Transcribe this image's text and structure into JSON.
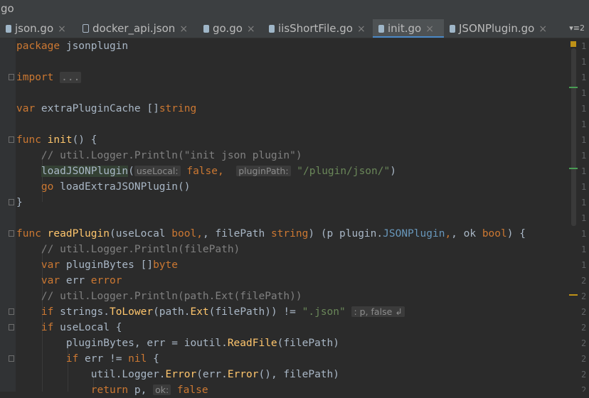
{
  "window": {
    "title": "go"
  },
  "tabs": [
    {
      "label": "json.go",
      "icon": "go-file-icon",
      "active": false
    },
    {
      "label": "docker_api.json",
      "icon": "json-file-icon",
      "active": false
    },
    {
      "label": "go.go",
      "icon": "go-file-icon",
      "active": false
    },
    {
      "label": "iisShortFile.go",
      "icon": "go-file-icon",
      "active": false
    },
    {
      "label": "init.go",
      "icon": "go-file-icon",
      "active": true
    },
    {
      "label": "JSONPlugin.go",
      "icon": "go-file-icon",
      "active": false
    }
  ],
  "tab_close_glyph": "×",
  "tab_overflow": {
    "label": "≡2"
  },
  "code": {
    "package_kw": "package",
    "package_name": " jsonplugin",
    "import_kw": "import",
    "import_collapsed": "...",
    "var_kw": "var",
    "extra_cache": " extraPluginCache []",
    "string_type": "string",
    "func_kw": "func",
    "init_name": "init",
    "init_sig": "() {",
    "comment_init": "// util.Logger.Println(\"init json plugin\")",
    "load_fn": "loadJSONPlugin",
    "load_open": "(",
    "hint_use_local": "useLocal:",
    "false_kw": "false",
    "comma": ", ",
    "hint_plugin_path": "pluginPath:",
    "plugin_path_str": "\"/plugin/json/\"",
    "close_paren": ")",
    "go_kw": "go",
    "load_extra": " loadExtraJSONPlugin()",
    "close_brace": "}",
    "read_plugin": "readPlugin",
    "read_sig_a": "(useLocal ",
    "bool_kw": "bool",
    "read_sig_b": ", filePath ",
    "read_sig_c": ") (p ",
    "plugin_pkg": "plugin.",
    "plugin_type": "JSONPlugin",
    "read_sig_d": ", ok ",
    "read_sig_e": ") {",
    "comment_filepath": "// util.Logger.Println(filePath)",
    "plugin_bytes": " pluginBytes []",
    "byte_kw": "byte",
    "err_decl": " err ",
    "error_kw": "error",
    "comment_ext": "// util.Logger.Println(path.Ext(filePath))",
    "if_kw": "if",
    "if_strings": " strings.",
    "to_lower": "ToLower",
    "path_ext_a": "(path.",
    "ext_fn": "Ext",
    "path_ext_b": "(filePath)) != ",
    "json_str": "\".json\"",
    "hint_return": ": p, false ↲",
    "if_use_local": " useLocal {",
    "plugin_bytes_assign": "pluginBytes, err = ioutil.",
    "read_file": "ReadFile",
    "read_file_args": "(filePath)",
    "if_err": " err != ",
    "nil_kw": "nil",
    "open_brace": " {",
    "util_logger": "util.Logger.",
    "error_fn": "Error",
    "err_error_a": "(err.",
    "err_error_b": "(), filePath)",
    "return_kw": "return",
    "return_p": " p, ",
    "hint_ok": "ok:",
    "return_false": " false"
  },
  "right_gutter_digits": [
    "1",
    "1",
    "1",
    "1",
    "1",
    "1",
    "1",
    "1",
    "1",
    "1",
    "1",
    "1",
    "1",
    "1",
    "1",
    "2",
    "2",
    "2",
    "2",
    "2",
    "2",
    "2",
    "2"
  ],
  "colors": {
    "background": "#2b2b2b",
    "keyword": "#cc7832",
    "string": "#6a8759",
    "comment": "#808080",
    "function": "#ffc66d",
    "type_name": "#6897bb",
    "active_tab_underline": "#4a88c7",
    "warning_marker": "#be9117",
    "change_marker": "#499c54"
  }
}
